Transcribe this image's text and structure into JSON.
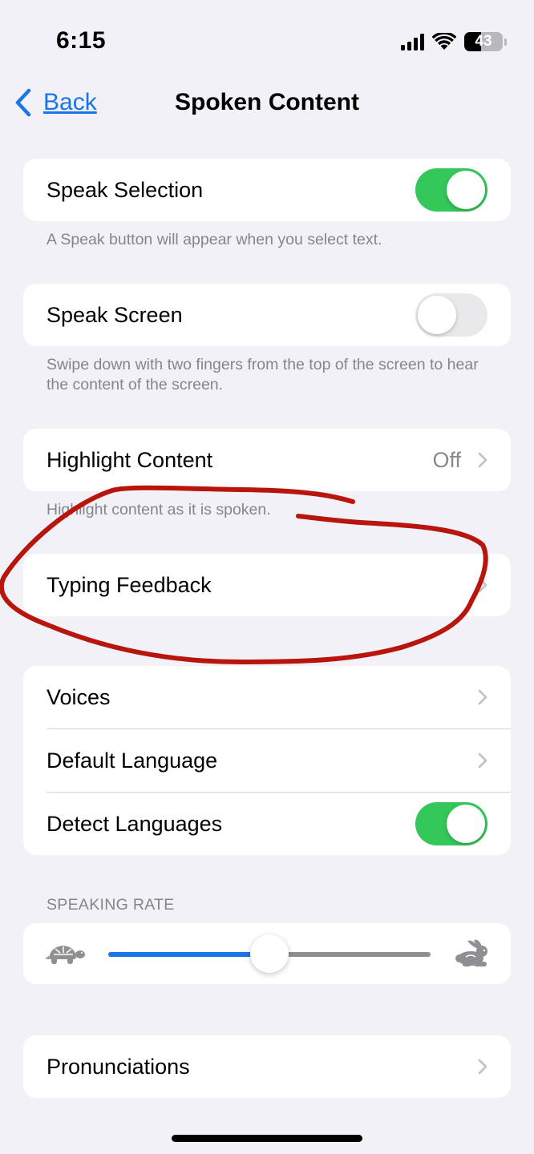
{
  "status_bar": {
    "time": "6:15",
    "battery_level": "43"
  },
  "nav": {
    "back_label": "Back",
    "title": "Spoken Content"
  },
  "speak_selection": {
    "label": "Speak Selection",
    "enabled": true,
    "footnote": "A Speak button will appear when you select text."
  },
  "speak_screen": {
    "label": "Speak Screen",
    "enabled": false,
    "footnote": "Swipe down with two fingers from the top of the screen to hear the content of the screen."
  },
  "highlight_content": {
    "label": "Highlight Content",
    "value": "Off",
    "footnote": "Highlight content as it is spoken."
  },
  "typing_feedback": {
    "label": "Typing Feedback"
  },
  "voices_group": {
    "voices_label": "Voices",
    "default_language_label": "Default Language",
    "detect_languages_label": "Detect Languages",
    "detect_languages_enabled": true
  },
  "speaking_rate": {
    "header": "SPEAKING RATE",
    "value_fraction": 0.5
  },
  "pronunciations": {
    "label": "Pronunciations"
  },
  "colors": {
    "accent_blue": "#1a75e6",
    "toggle_green": "#34c759",
    "annotation_red": "#b8150d",
    "background": "#f2f1f7"
  }
}
